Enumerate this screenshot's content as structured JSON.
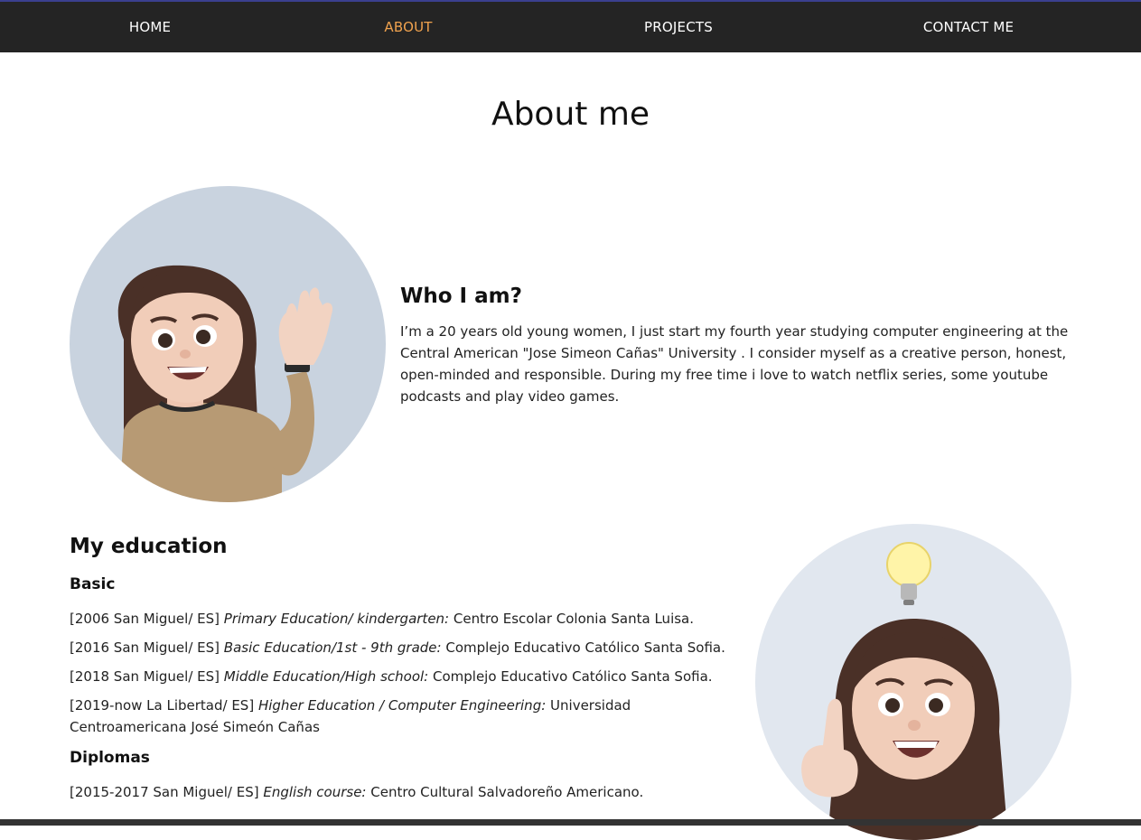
{
  "nav": {
    "home": "HOME",
    "about": "ABOUT",
    "projects": "PROJECTS",
    "contact": "CONTACT ME"
  },
  "page_title": "About me",
  "who": {
    "title": "Who I am?",
    "text": "I’m a 20 years old young women, I just start my fourth year studying computer engineering at the Central American \"Jose Simeon Cañas\" University . I consider myself as a creative person, honest, open-minded and responsible. During my free time i love to watch netflix series, some youtube podcasts and play video games."
  },
  "education": {
    "title": "My education",
    "basic_title": "Basic",
    "basic": [
      {
        "when": "[2006 San Miguel/ ES]",
        "what": "Primary Education/ kindergarten:",
        "where": "Centro Escolar Colonia Santa Luisa."
      },
      {
        "when": "[2016 San Miguel/ ES]",
        "what": "Basic Education/1st - 9th grade:",
        "where": "Complejo Educativo Católico Santa Sofia."
      },
      {
        "when": "[2018 San Miguel/ ES]",
        "what": "Middle Education/High school:",
        "where": "Complejo Educativo Católico Santa Sofia."
      },
      {
        "when": "[2019-now La Libertad/ ES]",
        "what": "Higher Education / Computer Engineering:",
        "where": "Universidad Centroamericana José Simeón Cañas"
      }
    ],
    "diplomas_title": "Diplomas",
    "diplomas": [
      {
        "when": "[2015-2017 San Miguel/ ES]",
        "what": "English course:",
        "where": "Centro Cultural Salvadoreño Americano."
      }
    ]
  },
  "colors": {
    "nav_bg": "#242424",
    "nav_active": "#f0a24e",
    "avatar1_bg": "#c9d3df",
    "avatar2_bg": "#e1e7ef"
  }
}
